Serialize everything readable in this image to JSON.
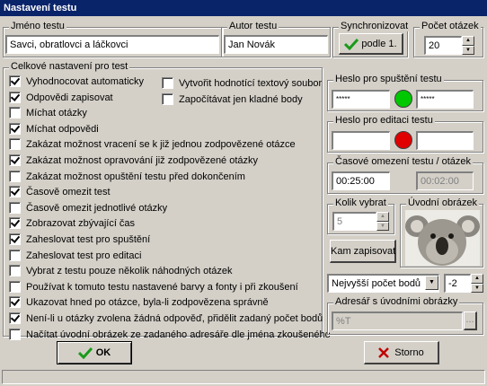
{
  "window": {
    "title": "Nastavení testu"
  },
  "test_name": {
    "label": "Jméno testu",
    "value": "Savci, obratlovci a láčkovci"
  },
  "author": {
    "label": "Autor testu",
    "value": "Jan Novák"
  },
  "sync": {
    "label": "Synchronizovat",
    "button": "podle 1."
  },
  "question_count": {
    "label": "Počet otázek",
    "value": "20"
  },
  "general": {
    "label": "Celkové nastavení pro test",
    "options": [
      {
        "label": "Vyhodnocovat automaticky",
        "checked": true
      },
      {
        "label": "Odpovědi zapisovat",
        "checked": true
      },
      {
        "label": "Míchat otázky",
        "checked": false
      },
      {
        "label": "Míchat odpovědi",
        "checked": true
      },
      {
        "label": "Zakázat možnost vracení se k již jednou zodpovězené otázce",
        "checked": false
      },
      {
        "label": "Zakázat možnost opravování již zodpovězené otázky",
        "checked": true
      },
      {
        "label": "Zakázat možnost opuštění testu před dokončením",
        "checked": false
      },
      {
        "label": "Časově omezit test",
        "checked": true
      },
      {
        "label": "Časově omezit jednotlivé otázky",
        "checked": false
      },
      {
        "label": "Zobrazovat zbývající čas",
        "checked": true
      },
      {
        "label": "Zaheslovat test pro spuštění",
        "checked": true
      },
      {
        "label": "Zaheslovat test pro editaci",
        "checked": false
      },
      {
        "label": "Vybrat z testu pouze několik náhodných otázek",
        "checked": false
      },
      {
        "label": "Používat k tomuto testu nastavené barvy a fonty i při zkoušení",
        "checked": false
      },
      {
        "label": "Ukazovat hned po otázce, byla-li zodpovězena správně",
        "checked": true
      },
      {
        "label": "Není-li u otázky zvolena žádná odpověď, přidělit zadaný počet bodů",
        "checked": true
      },
      {
        "label": "Načítat úvodní obrázek ze zadaného adresáře dle jména zkoušeného",
        "checked": false
      }
    ],
    "extra": [
      {
        "label": "Vytvořit hodnotící textový soubor",
        "checked": false
      },
      {
        "label": "Započítávat jen kladné body",
        "checked": false
      }
    ]
  },
  "start_password": {
    "label": "Heslo pro spuštění testu",
    "value1": "*****",
    "value2": "*****",
    "status_color": "#00c800"
  },
  "edit_password": {
    "label": "Heslo pro editaci testu",
    "value1": "",
    "value2": "",
    "status_color": "#e00000"
  },
  "time_limit": {
    "label": "Časové omezení testu / otázek",
    "test": "00:25:00",
    "question": "00:02:00"
  },
  "pick_count": {
    "label": "Kolik vybrat",
    "value": "5"
  },
  "intro_image": {
    "label": "Úvodní obrázek"
  },
  "save_where_button": "Kam zapisovat",
  "points_select": {
    "value": "Nejvyšší počet bodů",
    "number": "-2"
  },
  "image_dir": {
    "label": "Adresář s úvodními obrázky",
    "value": "%T",
    "browse": "..."
  },
  "ok_button": "OK",
  "cancel_button": "Storno"
}
